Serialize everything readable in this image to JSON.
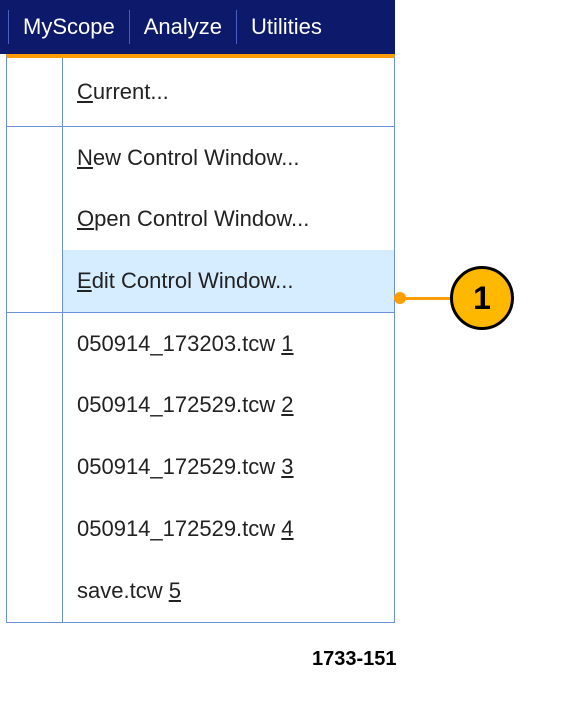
{
  "menubar": {
    "myscope": "MyScope",
    "analyze": "Analyze",
    "utilities": "Utilities"
  },
  "menu": {
    "current": {
      "pre": "",
      "m": "C",
      "post": "urrent..."
    },
    "new": {
      "pre": "",
      "m": "N",
      "post": "ew Control Window..."
    },
    "open": {
      "pre": "",
      "m": "O",
      "post": "pen Control Window..."
    },
    "edit": {
      "pre": "",
      "m": "E",
      "post": "dit Control Window..."
    },
    "recent": [
      {
        "pre": "050914_173203.tcw ",
        "m": "1",
        "post": ""
      },
      {
        "pre": "050914_172529.tcw ",
        "m": "2",
        "post": ""
      },
      {
        "pre": "050914_172529.tcw ",
        "m": "3",
        "post": ""
      },
      {
        "pre": "050914_172529.tcw ",
        "m": "4",
        "post": ""
      },
      {
        "pre": "save.tcw ",
        "m": "5",
        "post": ""
      }
    ]
  },
  "callout": {
    "label": "1"
  },
  "footer_id": "1733-151"
}
